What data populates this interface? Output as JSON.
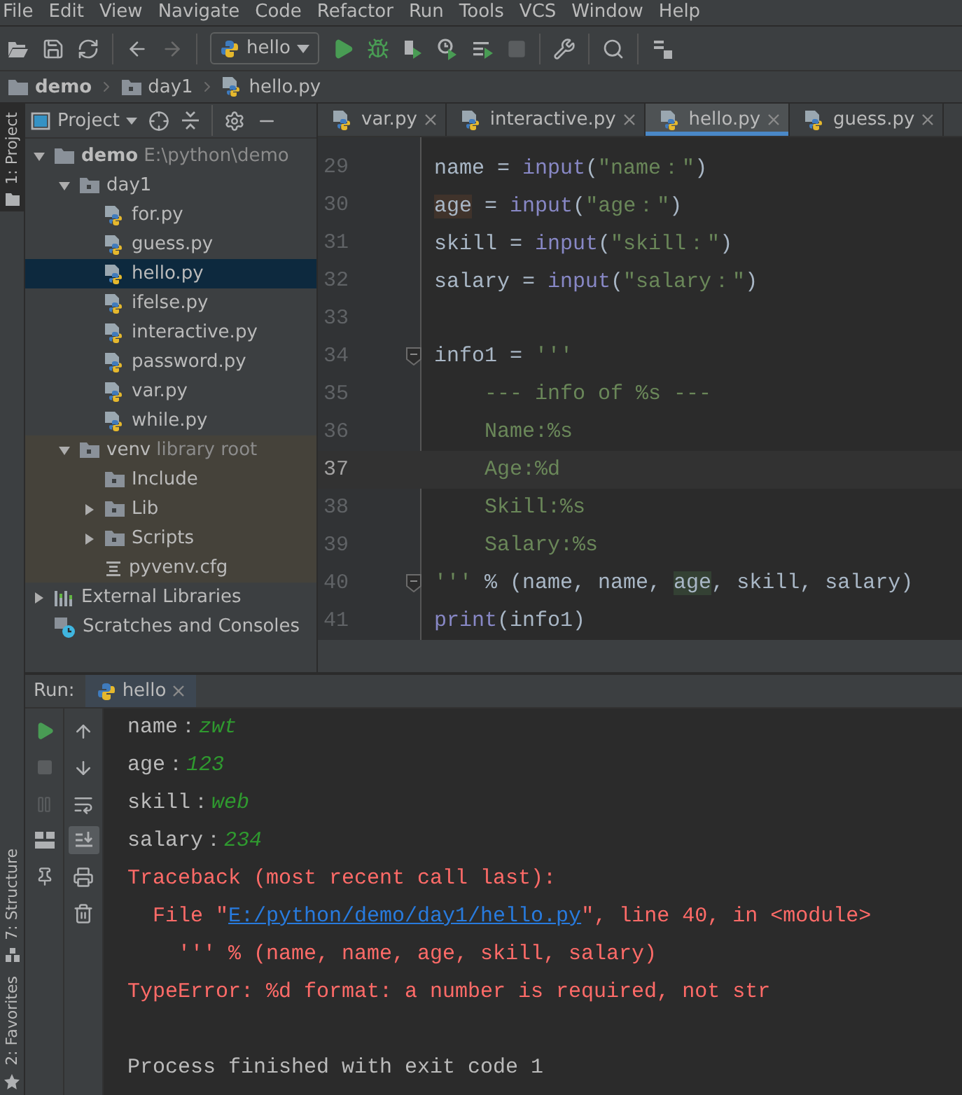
{
  "menu": [
    "File",
    "Edit",
    "View",
    "Navigate",
    "Code",
    "Refactor",
    "Run",
    "Tools",
    "VCS",
    "Window",
    "Help"
  ],
  "toolbar": {
    "run_config": "hello"
  },
  "breadcrumb": [
    {
      "label": "demo",
      "kind": "module"
    },
    {
      "label": "day1",
      "kind": "folder"
    },
    {
      "label": "hello.py",
      "kind": "python-file"
    }
  ],
  "left_stripe": {
    "top": [
      {
        "label": "1: Project",
        "selected": true
      }
    ],
    "bottom": [
      {
        "label": "7: Structure",
        "selected": false,
        "kind": "structure"
      },
      {
        "label": "2: Favorites",
        "selected": false,
        "kind": "favorites"
      }
    ]
  },
  "project": {
    "title": "Project",
    "tree": [
      {
        "label": "demo",
        "hint": "E:\\python\\demo",
        "kind": "module",
        "expanded": true,
        "selected": false,
        "children": [
          {
            "label": "day1",
            "kind": "folder",
            "expanded": true,
            "selected": false,
            "children": [
              {
                "label": "for.py",
                "kind": "python-file",
                "selected": false
              },
              {
                "label": "guess.py",
                "kind": "python-file",
                "selected": false
              },
              {
                "label": "hello.py",
                "kind": "python-file",
                "selected": true
              },
              {
                "label": "ifelse.py",
                "kind": "python-file",
                "selected": false
              },
              {
                "label": "interactive.py",
                "kind": "python-file",
                "selected": false
              },
              {
                "label": "password.py",
                "kind": "python-file",
                "selected": false
              },
              {
                "label": "var.py",
                "kind": "python-file",
                "selected": false
              },
              {
                "label": "while.py",
                "kind": "python-file",
                "selected": false
              }
            ]
          },
          {
            "label": "venv",
            "hint": "library root",
            "kind": "library-root",
            "expanded": true,
            "selected": false,
            "children": [
              {
                "label": "Include",
                "kind": "folder",
                "selected": false
              },
              {
                "label": "Lib",
                "kind": "folder",
                "expanded": false,
                "selected": false
              },
              {
                "label": "Scripts",
                "kind": "folder",
                "expanded": false,
                "selected": false
              },
              {
                "label": "pyvenv.cfg",
                "kind": "config-file",
                "selected": false
              }
            ]
          }
        ]
      },
      {
        "label": "External Libraries",
        "kind": "libraries",
        "expanded": false,
        "selected": false
      },
      {
        "label": "Scratches and Consoles",
        "kind": "scratches",
        "selected": false
      }
    ]
  },
  "editor": {
    "tabs": [
      {
        "label": "var.py",
        "selected": false
      },
      {
        "label": "interactive.py",
        "selected": false
      },
      {
        "label": "hello.py",
        "selected": true
      },
      {
        "label": "guess.py",
        "selected": false
      }
    ],
    "lines": [
      {
        "number": "29",
        "current": false,
        "tokens": [
          {
            "text": "name = ",
            "kind": "plain"
          },
          {
            "text": "input",
            "kind": "builtin"
          },
          {
            "text": "(",
            "kind": "plain"
          },
          {
            "text": "\"name：\"",
            "kind": "string"
          },
          {
            "text": ")",
            "kind": "plain"
          }
        ]
      },
      {
        "number": "30",
        "current": false,
        "tokens": [
          {
            "text": "age",
            "kind": "write-usage"
          },
          {
            "text": " = ",
            "kind": "plain"
          },
          {
            "text": "input",
            "kind": "builtin"
          },
          {
            "text": "(",
            "kind": "plain"
          },
          {
            "text": "\"age：\"",
            "kind": "string"
          },
          {
            "text": ")",
            "kind": "plain"
          }
        ]
      },
      {
        "number": "31",
        "current": false,
        "tokens": [
          {
            "text": "skill = ",
            "kind": "plain"
          },
          {
            "text": "input",
            "kind": "builtin"
          },
          {
            "text": "(",
            "kind": "plain"
          },
          {
            "text": "\"skill：\"",
            "kind": "string"
          },
          {
            "text": ")",
            "kind": "plain"
          }
        ]
      },
      {
        "number": "32",
        "current": false,
        "tokens": [
          {
            "text": "salary = ",
            "kind": "plain"
          },
          {
            "text": "input",
            "kind": "builtin"
          },
          {
            "text": "(",
            "kind": "plain"
          },
          {
            "text": "\"salary：\"",
            "kind": "string"
          },
          {
            "text": ")",
            "kind": "plain"
          }
        ]
      },
      {
        "number": "33",
        "current": false
      },
      {
        "number": "34",
        "current": false,
        "fold": true,
        "tokens": [
          {
            "text": "info1 = ",
            "kind": "plain"
          },
          {
            "text": "'''",
            "kind": "string"
          }
        ]
      },
      {
        "number": "35",
        "current": false,
        "tokens": [
          {
            "text": "    --- info of %s ---",
            "kind": "string"
          }
        ]
      },
      {
        "number": "36",
        "current": false,
        "tokens": [
          {
            "text": "    Name:%s",
            "kind": "string"
          }
        ]
      },
      {
        "number": "37",
        "current": true,
        "tokens": [
          {
            "text": "    Age:%d",
            "kind": "string"
          }
        ]
      },
      {
        "number": "38",
        "current": false,
        "tokens": [
          {
            "text": "    Skill:%s",
            "kind": "string"
          }
        ]
      },
      {
        "number": "39",
        "current": false,
        "tokens": [
          {
            "text": "    Salary:%s",
            "kind": "string"
          }
        ]
      },
      {
        "number": "40",
        "current": false,
        "fold": true,
        "tokens": [
          {
            "text": "'''",
            "kind": "string"
          },
          {
            "text": " % (name, name, ",
            "kind": "plain"
          },
          {
            "text": "age",
            "kind": "read-usage"
          },
          {
            "text": ", skill, salary)",
            "kind": "plain"
          }
        ]
      },
      {
        "number": "41",
        "current": false,
        "tokens": [
          {
            "text": "print",
            "kind": "builtin"
          },
          {
            "text": "(info1)",
            "kind": "plain"
          }
        ]
      }
    ]
  },
  "run": {
    "label": "Run:",
    "tabs": [
      {
        "label": "hello",
        "selected": true
      }
    ],
    "scroll_to_end": true,
    "console": [
      {
        "segments": [
          {
            "text": "name：",
            "kind": "output"
          },
          {
            "text": "zwt",
            "kind": "input"
          }
        ]
      },
      {
        "segments": [
          {
            "text": "age：",
            "kind": "output"
          },
          {
            "text": "123",
            "kind": "input"
          }
        ]
      },
      {
        "segments": [
          {
            "text": "skill：",
            "kind": "output"
          },
          {
            "text": "web",
            "kind": "input"
          }
        ]
      },
      {
        "segments": [
          {
            "text": "salary：",
            "kind": "output"
          },
          {
            "text": "234",
            "kind": "input"
          }
        ]
      },
      {
        "segments": [
          {
            "text": "Traceback (most recent call last):",
            "kind": "error"
          }
        ]
      },
      {
        "segments": [
          {
            "text": "  File \"",
            "kind": "error"
          },
          {
            "text": "E:/python/demo/day1/hello.py",
            "kind": "link"
          },
          {
            "text": "\", line 40, in <module>",
            "kind": "error"
          }
        ]
      },
      {
        "segments": [
          {
            "text": "    ''' % (name, name, age, skill, salary)",
            "kind": "error"
          }
        ]
      },
      {
        "segments": [
          {
            "text": "TypeError: %d format: a number is required, not str",
            "kind": "error"
          }
        ]
      },
      {
        "separated": true,
        "segments": [
          {
            "text": "Process finished with exit code 1",
            "kind": "output"
          }
        ]
      }
    ]
  }
}
